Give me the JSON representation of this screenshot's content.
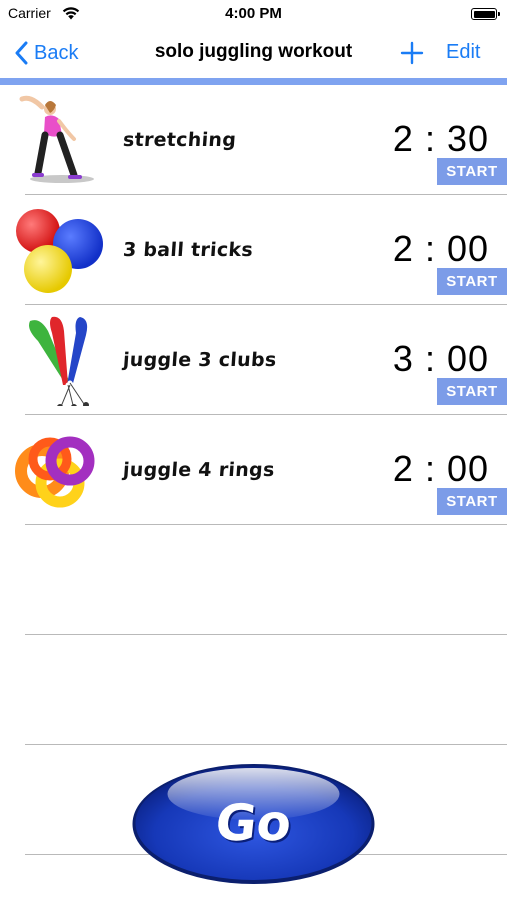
{
  "status_bar": {
    "carrier": "Carrier",
    "time": "4:00 PM"
  },
  "nav": {
    "back_label": "Back",
    "title": "solo juggling workout",
    "edit_label": "Edit"
  },
  "colors": {
    "accent": "#1a7cf5",
    "strip": "#7fa3f0",
    "start_button": "#7c9ce8",
    "go_button": "#1638b8"
  },
  "exercises": [
    {
      "name": "stretching",
      "time": "2 : 30",
      "start_label": "START",
      "icon": "stretching-figure-icon"
    },
    {
      "name": "3 ball tricks",
      "time": "2 : 00",
      "start_label": "START",
      "icon": "juggling-balls-icon"
    },
    {
      "name": "juggle 3 clubs",
      "time": "3 : 00",
      "start_label": "START",
      "icon": "juggling-clubs-icon"
    },
    {
      "name": "juggle 4 rings",
      "time": "2 : 00",
      "start_label": "START",
      "icon": "juggling-rings-icon"
    }
  ],
  "go_button": {
    "label": "Go"
  }
}
